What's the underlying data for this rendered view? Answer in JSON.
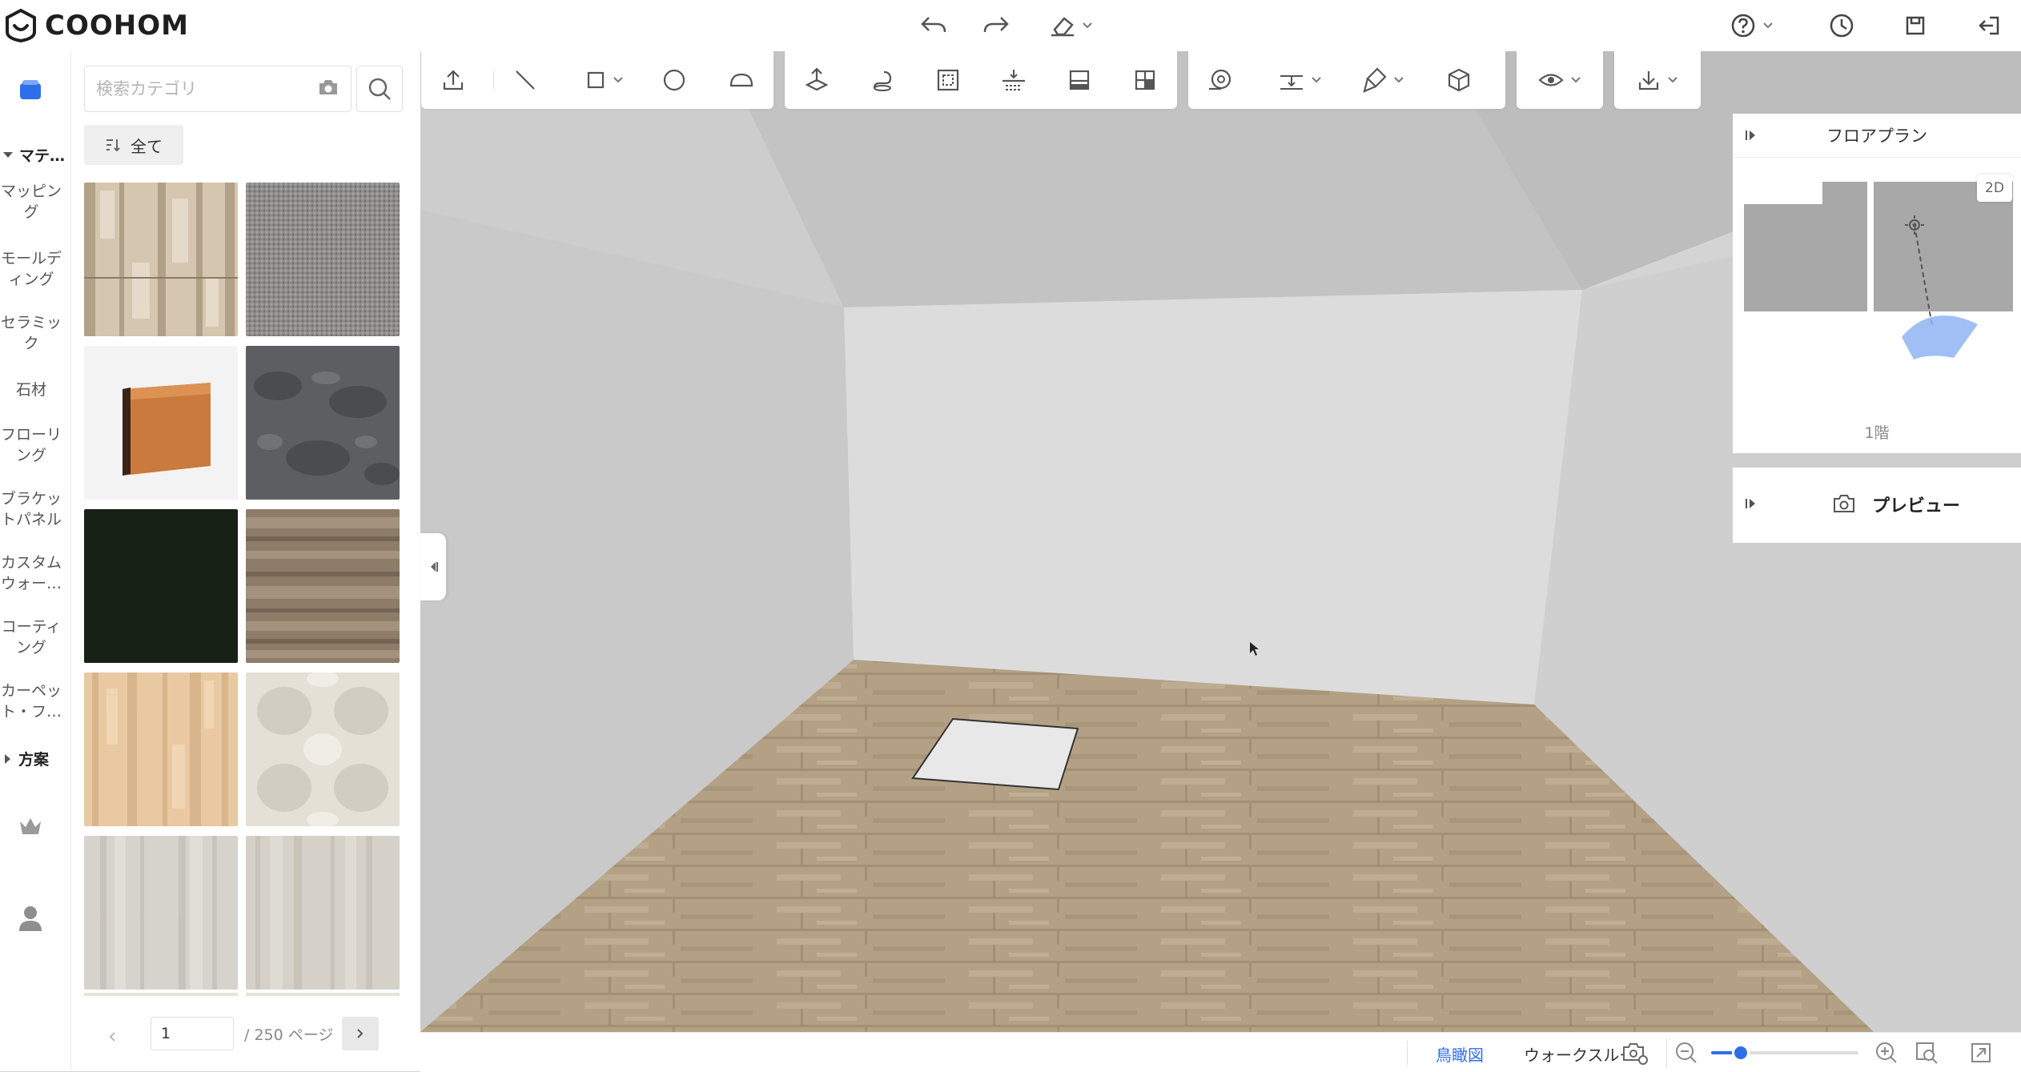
{
  "app": {
    "logo_text": "COOHOM"
  },
  "topbar": {
    "undo_icon": "undo-icon",
    "redo_icon": "redo-icon",
    "eraser_icon": "eraser-icon",
    "help_icon": "help-icon",
    "history_icon": "clock-icon",
    "save_icon": "save-icon",
    "exit_icon": "exit-icon"
  },
  "sidebar": {
    "materials_heading": "マテ…",
    "scheme_heading": "方案",
    "items": [
      {
        "label": "マッピン\nグ"
      },
      {
        "label": "モールデ\nィング"
      },
      {
        "label": "セラミッ\nク"
      },
      {
        "label": "石材"
      },
      {
        "label": "フローリ\nング"
      },
      {
        "label": "ブラケッ\nトパネル"
      },
      {
        "label": "カスタム\nウォー…"
      },
      {
        "label": "コーティ\nング"
      },
      {
        "label": "カーペッ\nト・フ…"
      }
    ]
  },
  "catalog": {
    "search_placeholder": "検索カテゴリ",
    "filter_label": "全て",
    "tiles": [
      {
        "name": "wood-planks-whitewashed"
      },
      {
        "name": "gray-carpet"
      },
      {
        "name": "wooden-baseboard"
      },
      {
        "name": "dark-gray-stone"
      },
      {
        "name": "black-green-solid"
      },
      {
        "name": "brown-wood-grain"
      },
      {
        "name": "light-tan-wood"
      },
      {
        "name": "cream-marble"
      },
      {
        "name": "pale-gray-wood"
      },
      {
        "name": "pale-beige-wood"
      }
    ],
    "pager": {
      "current_page": "1",
      "total_label": "/ 250 ページ"
    }
  },
  "floorplan": {
    "title": "フロアプラン",
    "mode_badge": "2D",
    "floor_label": "1階"
  },
  "preview": {
    "title": "プレビュー"
  },
  "bottombar": {
    "tab_birdseye": "鳥瞰図",
    "tab_walkthrough": "ウォークスルー",
    "zoom_level": 0.2
  },
  "colors": {
    "accent": "#2d6fe8",
    "floor": "#b4a185",
    "wall_back": "#dcdcdc",
    "ceiling": "#c4c4c4"
  }
}
